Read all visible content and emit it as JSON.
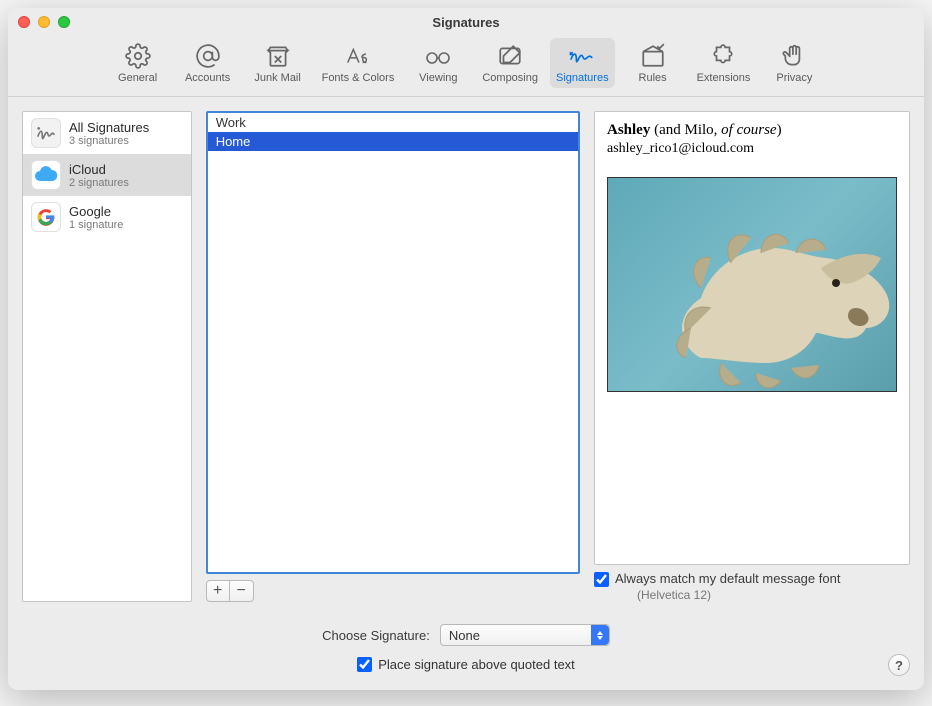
{
  "window": {
    "title": "Signatures"
  },
  "toolbar": [
    {
      "label": "General",
      "icon": "gear-icon",
      "selected": false
    },
    {
      "label": "Accounts",
      "icon": "at-icon",
      "selected": false
    },
    {
      "label": "Junk Mail",
      "icon": "bin-icon",
      "selected": false
    },
    {
      "label": "Fonts & Colors",
      "icon": "fonts-icon",
      "selected": false
    },
    {
      "label": "Viewing",
      "icon": "glasses-icon",
      "selected": false
    },
    {
      "label": "Composing",
      "icon": "compose-icon",
      "selected": false
    },
    {
      "label": "Signatures",
      "icon": "signature-icon",
      "selected": true
    },
    {
      "label": "Rules",
      "icon": "rules-icon",
      "selected": false
    },
    {
      "label": "Extensions",
      "icon": "puzzle-icon",
      "selected": false
    },
    {
      "label": "Privacy",
      "icon": "hand-icon",
      "selected": false
    }
  ],
  "accounts": [
    {
      "title": "All Signatures",
      "sub": "3 signatures",
      "icon": "allsig",
      "selected": false
    },
    {
      "title": "iCloud",
      "sub": "2 signatures",
      "icon": "icloud",
      "selected": true
    },
    {
      "title": "Google",
      "sub": "1 signature",
      "icon": "google",
      "selected": false
    }
  ],
  "signatures": [
    {
      "name": "Work",
      "selected": false
    },
    {
      "name": "Home",
      "selected": true
    }
  ],
  "preview": {
    "name_bold": "Ashley",
    "name_paren_pre": " (and Milo, ",
    "name_italic": "of course",
    "name_paren_post": ")",
    "email": "ashley_rico1@icloud.com"
  },
  "options": {
    "match_font_label": "Always match my default message font",
    "match_font_sub": "(Helvetica 12)",
    "match_font_checked": true,
    "choose_label": "Choose Signature:",
    "choose_value": "None",
    "place_above_label": "Place signature above quoted text",
    "place_above_checked": true
  },
  "buttons": {
    "add": "+",
    "remove": "−",
    "help": "?"
  }
}
